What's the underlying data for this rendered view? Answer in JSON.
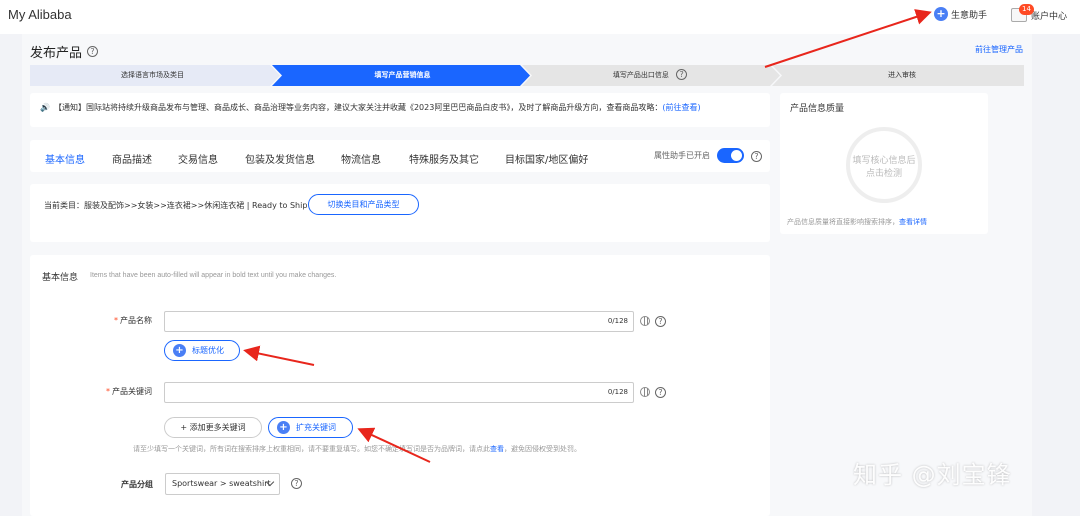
{
  "topbar": {
    "brand": "My Alibaba",
    "assistant_label": "生意助手",
    "account_label": "账户中心",
    "account_badge": "14"
  },
  "page": {
    "title": "发布产品",
    "manage_link": "前往管理产品"
  },
  "steps": [
    {
      "label": "选择语言市场及类目",
      "state": "done"
    },
    {
      "label": "填写产品营销信息",
      "state": "active"
    },
    {
      "label": "填写产品出口信息",
      "state": "todo"
    },
    {
      "label": "进入审核",
      "state": "todo"
    }
  ],
  "notice": {
    "text": "【通知】国际站将持续升级商品发布与管理、商品成长、商品治理等业务内容，建议大家关注并收藏《2023阿里巴巴商品白皮书》，及时了解商品升级方向，查看商品攻略：",
    "link": "(前往查看)"
  },
  "tabs": [
    "基本信息",
    "商品描述",
    "交易信息",
    "包装及发货信息",
    "物流信息",
    "特殊服务及其它",
    "目标国家/地区偏好"
  ],
  "attr_helper": {
    "label": "属性助手已开启",
    "enabled": true
  },
  "category": {
    "text": "当前类目：服装及配饰>>女装>>连衣裙>>休闲连衣裙 | Ready to Ship",
    "button": "切换类目和产品类型"
  },
  "basic_info": {
    "title": "基本信息",
    "hint": "Items that have been auto-filled will appear in bold text until you make changes.",
    "product_name": {
      "label": "产品名称",
      "counter": "0/128",
      "value": ""
    },
    "title_opt_button": "标题优化",
    "keyword": {
      "label": "产品关键词",
      "counter": "0/128",
      "value": ""
    },
    "add_keyword_button": "+ 添加更多关键词",
    "expand_keyword_button": "扩充关键词",
    "tip": "请至少填写一个关键词，所有词在搜索排序上权重相同，请不要重复填写。如您不确定填写词是否为品牌词，请点此",
    "tip_link": "查看",
    "tip_tail": "，避免因侵权受到处罚。",
    "group": {
      "label": "产品分组",
      "value": "Sportswear > sweatshirt"
    }
  },
  "quality": {
    "title": "产品信息质量",
    "circle_line1": "填写核心信息后",
    "circle_line2": "点击检测",
    "note": "产品信息质量将直接影响搜索排序，",
    "note_link": "查看详情"
  },
  "watermark": "知乎 @刘宝锋",
  "colors": {
    "accent": "#1a66ff",
    "arrow": "#e8261c",
    "step_done": "#e6eaf6",
    "step_active": "#1a66ff",
    "step_todo": "#e5e5e5"
  }
}
